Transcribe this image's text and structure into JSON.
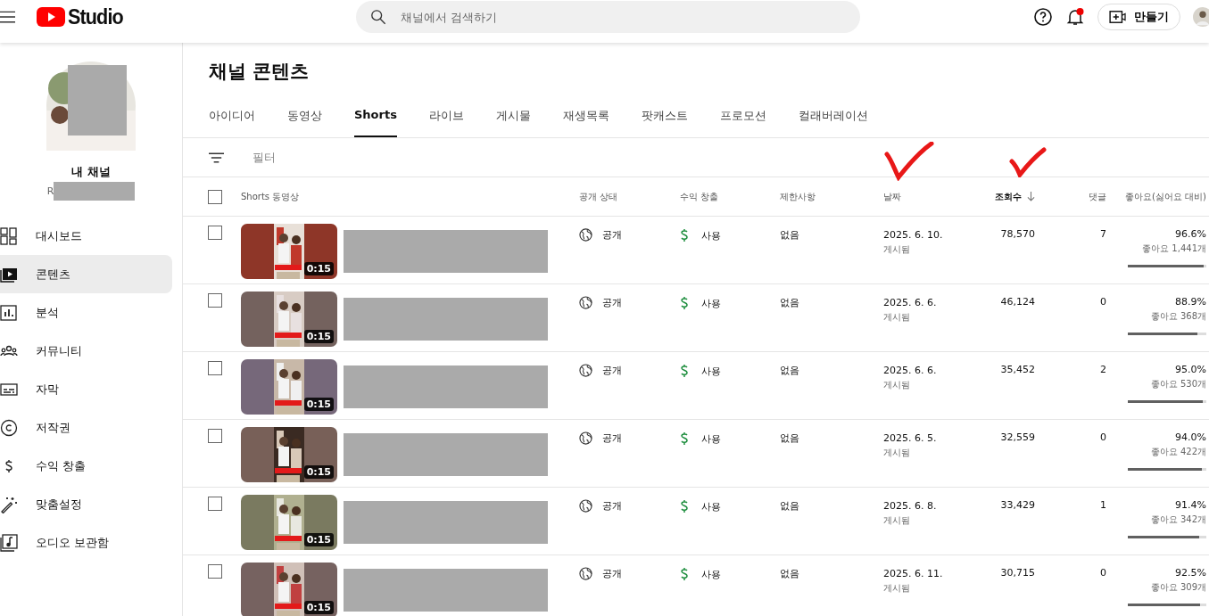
{
  "header": {
    "logo_text": "Studio",
    "search": {
      "placeholder": "채널에서 검색하기"
    },
    "create_button": "만들기",
    "notification_dot": true
  },
  "channel": {
    "name": "내 채널",
    "handle": "R"
  },
  "sidebar": {
    "items": [
      {
        "label": "대시보드",
        "kind": "dashboard",
        "selected": false
      },
      {
        "label": "콘텐츠",
        "kind": "content",
        "selected": true
      },
      {
        "label": "분석",
        "kind": "analytics",
        "selected": false
      },
      {
        "label": "커뮤니티",
        "kind": "community",
        "selected": false
      },
      {
        "label": "자막",
        "kind": "subtitles",
        "selected": false
      },
      {
        "label": "저작권",
        "kind": "copyright",
        "selected": false
      },
      {
        "label": "수익 창출",
        "kind": "money",
        "selected": false
      },
      {
        "label": "맞춤설정",
        "kind": "wand",
        "selected": false
      },
      {
        "label": "오디오 보관함",
        "kind": "audio",
        "selected": false
      }
    ]
  },
  "page_title": "채널 콘텐츠",
  "tabs": [
    {
      "label": "아이디어",
      "selected": false
    },
    {
      "label": "동영상",
      "selected": false
    },
    {
      "label": "Shorts",
      "selected": true
    },
    {
      "label": "라이브",
      "selected": false
    },
    {
      "label": "게시물",
      "selected": false
    },
    {
      "label": "재생목록",
      "selected": false
    },
    {
      "label": "팟캐스트",
      "selected": false
    },
    {
      "label": "프로모션",
      "selected": false
    },
    {
      "label": "컬래버레이션",
      "selected": false
    }
  ],
  "filter": {
    "placeholder": "필터"
  },
  "table": {
    "all_checked": false,
    "columns": [
      {
        "label": "Shorts 동영상",
        "sorted": false
      },
      {
        "label": "공개 상태",
        "sorted": false
      },
      {
        "label": "수익 창출",
        "sorted": false
      },
      {
        "label": "제한사항",
        "sorted": false
      },
      {
        "label": "날짜",
        "sorted": false
      },
      {
        "label": "조회수",
        "sorted": true
      },
      {
        "label": "댓글",
        "sorted": false
      },
      {
        "label": "좋아요(싫어요 대비)",
        "sorted": false
      }
    ],
    "rows": [
      {
        "checked": false,
        "duration": "0:15",
        "visibility": "공개",
        "monetization": "사용",
        "restrictions": "없음",
        "date": "2025. 6. 10.",
        "date_status": "게시됨",
        "views": "78,570",
        "comments": "7",
        "like_ratio": "96.6%",
        "likes": "좋아요 1,441개",
        "level": 0.966
      },
      {
        "checked": false,
        "duration": "0:15",
        "visibility": "공개",
        "monetization": "사용",
        "restrictions": "없음",
        "date": "2025. 6. 6.",
        "date_status": "게시됨",
        "views": "46,124",
        "comments": "0",
        "like_ratio": "88.9%",
        "likes": "좋아요 368개",
        "level": 0.889
      },
      {
        "checked": false,
        "duration": "0:15",
        "visibility": "공개",
        "monetization": "사용",
        "restrictions": "없음",
        "date": "2025. 6. 6.",
        "date_status": "게시됨",
        "views": "35,452",
        "comments": "2",
        "like_ratio": "95.0%",
        "likes": "좋아요 530개",
        "level": 0.95
      },
      {
        "checked": false,
        "duration": "0:15",
        "visibility": "공개",
        "monetization": "사용",
        "restrictions": "없음",
        "date": "2025. 6. 5.",
        "date_status": "게시됨",
        "views": "32,559",
        "comments": "0",
        "like_ratio": "94.0%",
        "likes": "좋아요 422개",
        "level": 0.94
      },
      {
        "checked": false,
        "duration": "0:15",
        "visibility": "공개",
        "monetization": "사용",
        "restrictions": "없음",
        "date": "2025. 6. 8.",
        "date_status": "게시됨",
        "views": "33,429",
        "comments": "1",
        "like_ratio": "91.4%",
        "likes": "좋아요 342개",
        "level": 0.914
      },
      {
        "checked": false,
        "duration": "0:15",
        "visibility": "공개",
        "monetization": "사용",
        "restrictions": "없음",
        "date": "2025. 6. 11.",
        "date_status": "게시됨",
        "views": "30,715",
        "comments": "0",
        "like_ratio": "92.5%",
        "likes": "좋아요 309개",
        "level": 0.925
      }
    ]
  }
}
